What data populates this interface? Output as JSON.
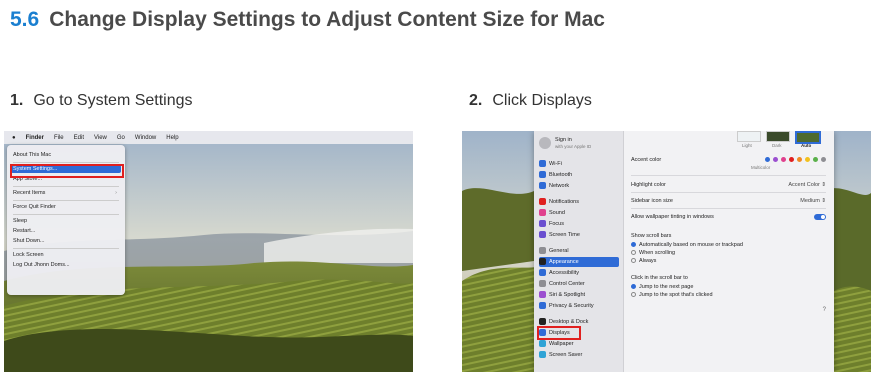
{
  "section": {
    "number": "5.6",
    "title": "Change Display Settings to Adjust Content Size for Mac"
  },
  "steps": [
    {
      "number": "1.",
      "text": "Go to System Settings"
    },
    {
      "number": "2.",
      "text": "Click Displays"
    }
  ],
  "screenshot1": {
    "menubar": [
      "Finder",
      "File",
      "Edit",
      "View",
      "Go",
      "Window",
      "Help"
    ],
    "apple_menu": [
      {
        "label": "About This Mac",
        "shortcut": ""
      },
      {
        "label": "System Settings...",
        "shortcut": ""
      },
      {
        "label": "App Store...",
        "shortcut": ""
      },
      {
        "label": "Recent Items",
        "shortcut": "›"
      },
      {
        "label": "Force Quit Finder",
        "shortcut": ""
      },
      {
        "label": "Sleep",
        "shortcut": ""
      },
      {
        "label": "Restart...",
        "shortcut": ""
      },
      {
        "label": "Shut Down...",
        "shortcut": ""
      },
      {
        "label": "Lock Screen",
        "shortcut": ""
      },
      {
        "label": "Log Out Jhonn Doms...",
        "shortcut": ""
      }
    ]
  },
  "screenshot2": {
    "account": {
      "name": "Sign in",
      "subtitle": "with your Apple ID"
    },
    "sidebar": [
      "Wi-Fi",
      "Bluetooth",
      "Network",
      "Notifications",
      "Sound",
      "Focus",
      "Screen Time",
      "General",
      "Appearance",
      "Accessibility",
      "Control Center",
      "Siri & Spotlight",
      "Privacy & Security",
      "Desktop & Dock",
      "Displays",
      "Wallpaper",
      "Screen Saver"
    ],
    "appearance_modes": [
      "Light",
      "Dark",
      "Auto"
    ],
    "rows": {
      "accent_color": "Accent color",
      "multicolor": "Multicolor",
      "highlight_color": "Highlight color",
      "highlight_value": "Accent Color ⇕",
      "sidebar_icon_size": "Sidebar icon size",
      "sidebar_icon_value": "Medium ⇕",
      "wallpaper_tinting": "Allow wallpaper tinting in windows",
      "show_scroll_bars": "Show scroll bars",
      "scroll_opt1": "Automatically based on mouse or trackpad",
      "scroll_opt2": "When scrolling",
      "scroll_opt3": "Always",
      "click_scroll": "Click in the scroll bar to",
      "click_opt1": "Jump to the next page",
      "click_opt2": "Jump to the spot that's clicked",
      "help": "?"
    },
    "accent_colors": [
      "#2f6bd6",
      "#9b4fd0",
      "#e0418e",
      "#e0201f",
      "#f08a24",
      "#f2c11e",
      "#5ab04a",
      "#8e8e93"
    ]
  }
}
